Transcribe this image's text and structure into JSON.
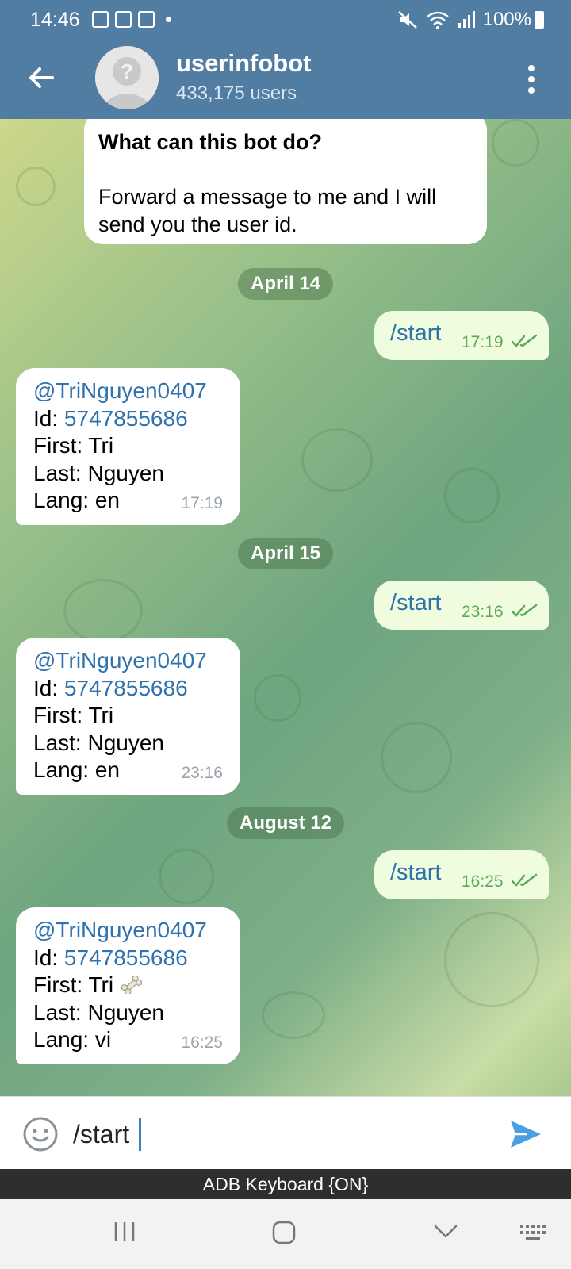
{
  "status_bar": {
    "time": "14:46",
    "battery": "100%",
    "icons": [
      "check-box-icon",
      "calendar-icon",
      "image-icon",
      "mute-icon",
      "wifi-icon",
      "signal-icon",
      "battery-icon"
    ]
  },
  "header": {
    "title": "userinfobot",
    "subtitle": "433,175 users"
  },
  "bot_info": {
    "title": "What can this bot do?",
    "body": "Forward a message to me and I will send you the user id."
  },
  "dates": [
    "April 14",
    "April 15",
    "August 12"
  ],
  "messages": [
    {
      "outgoing": {
        "text": "/start",
        "time": "17:19"
      },
      "reply": {
        "username": "@TriNguyen0407",
        "id_label": "Id: ",
        "id": "5747855686",
        "first": "First: Tri",
        "last": "Last: Nguyen",
        "lang": "Lang: en",
        "time": "17:19"
      }
    },
    {
      "outgoing": {
        "text": "/start",
        "time": "23:16"
      },
      "reply": {
        "username": "@TriNguyen0407",
        "id_label": "Id: ",
        "id": "5747855686",
        "first": "First: Tri",
        "last": "Last: Nguyen",
        "lang": "Lang: en",
        "time": "23:16"
      }
    },
    {
      "outgoing": {
        "text": "/start",
        "time": "16:25"
      },
      "reply": {
        "username": "@TriNguyen0407",
        "id_label": "Id: ",
        "id": "5747855686",
        "first": "First: Tri",
        "last": "Last: Nguyen",
        "lang": "Lang: vi",
        "time": "16:25"
      }
    }
  ],
  "input": {
    "value": "/start"
  },
  "keyboard_banner": "ADB Keyboard {ON}",
  "colors": {
    "header": "#517da2",
    "link": "#2f72ad",
    "outgoing_bubble": "#effdde",
    "read_check": "#5fa85a"
  }
}
